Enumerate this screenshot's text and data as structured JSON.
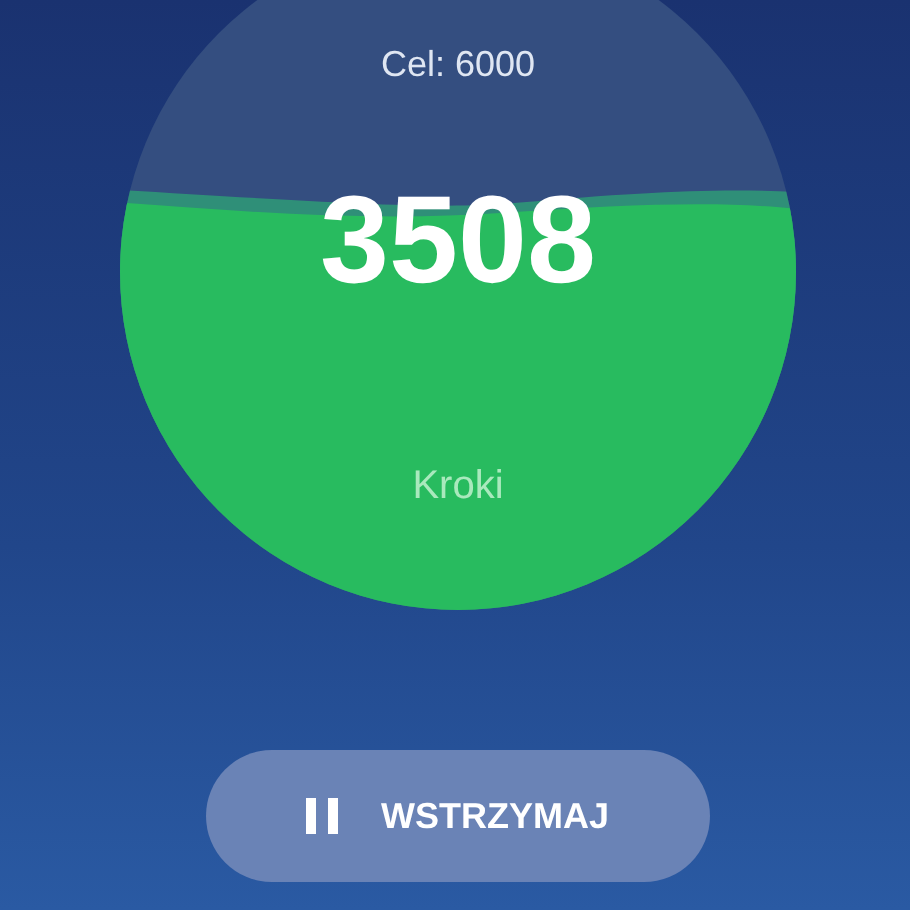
{
  "goal": "Cel: 6000",
  "count": "3508",
  "unit": "Kroki",
  "button": {
    "label": "WSTRZYMAJ"
  }
}
